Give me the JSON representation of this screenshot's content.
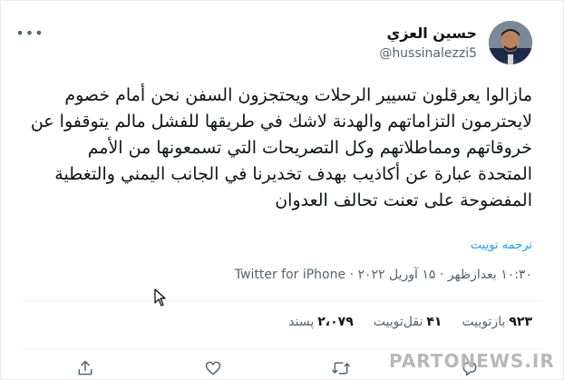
{
  "author": {
    "name": "حسين العزي",
    "handle": "@hussinalezzi5"
  },
  "tweet": {
    "text": "مازالوا يعرقلون تسيير الرحلات ويحتجزون السفن نحن أمام خصوم لايحترمون التزاماتهم والهدنة لاشك في طريقها للفشل مالم يتوقفوا عن خروقاتهم ومماطلاتهم وكل التصريحات التي تسمعونها من الأمم المتحدة عبارة عن أكاذيب بهدف تخديرنا في الجانب اليمني والتغطية المفضوحة على تعنت تحالف العدوان",
    "translate_label": "ترجمه توییت",
    "timestamp": "۱۰:۳۰ بعدازظهر · ۱۵ آوریل ۲۰۲۲ · Twitter for iPhone"
  },
  "stats": {
    "retweets_count": "۹۲۳",
    "retweets_label": "بازتوییت",
    "quotes_count": "۴۱",
    "quotes_label": "نقل‌توییت",
    "likes_count": "۲،۰۷۹",
    "likes_label": "پسند"
  },
  "icons": {
    "more": "more-dots-icon",
    "reply": "reply-icon",
    "retweet": "retweet-icon",
    "like": "heart-icon",
    "share": "share-icon"
  },
  "watermark": "PARTONEWS.IR",
  "colors": {
    "link": "#1d9bf0",
    "secondary_text": "#536471",
    "primary_text": "#0f1419"
  }
}
